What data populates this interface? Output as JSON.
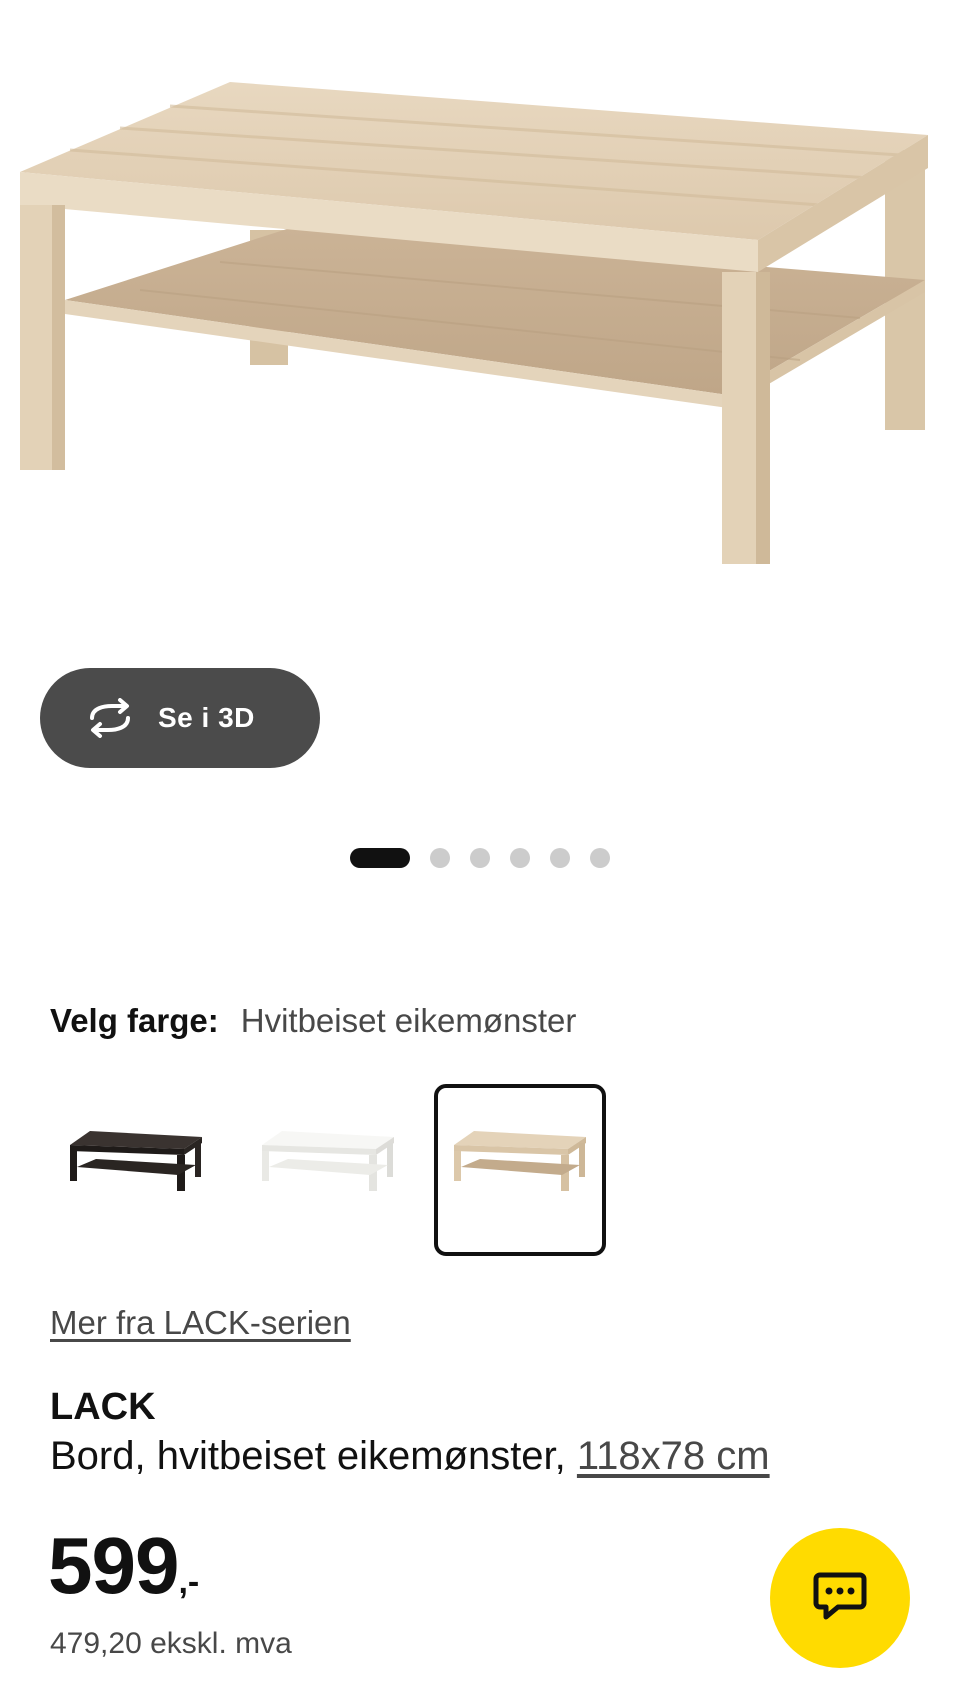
{
  "hero": {
    "image_alt": "LACK table in white stained oak effect",
    "view_3d_label": "Se i 3D",
    "view_3d_icon": "rotate-3d-icon"
  },
  "carousel": {
    "total": 6,
    "active_index": 1
  },
  "color_picker": {
    "heading": "Velg farge:",
    "selected_value": "Hvitbeiset eikemønster",
    "options": [
      {
        "name": "black-brown",
        "color": "#2a2522"
      },
      {
        "name": "white",
        "color": "#f4f4f2"
      },
      {
        "name": "white-stained-oak",
        "color": "#dcc6a8",
        "selected": true
      }
    ]
  },
  "series_link": "Mer fra LACK-serien",
  "product": {
    "name": "LACK",
    "description": "Bord, hvitbeiset eikemønster, ",
    "size": "118x78 cm"
  },
  "price": {
    "amount": "599",
    "suffix": ",-",
    "ex_vat": "479,20 ekskl. mva"
  },
  "chat": {
    "icon": "chat-icon",
    "color": "#ffdb00"
  },
  "colors": {
    "pill": "#4b4b4b",
    "accent": "#ffdb00",
    "dot_active": "#111111",
    "dot_inactive": "#cccccc"
  }
}
